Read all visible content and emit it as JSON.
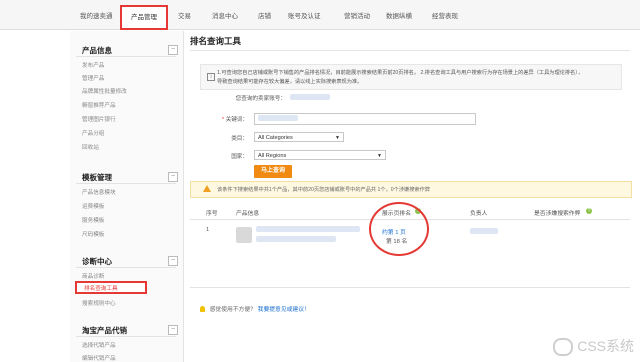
{
  "topnav": {
    "tabs": [
      {
        "label": "我的速卖通"
      },
      {
        "label": "产品管理"
      },
      {
        "label": "交易"
      },
      {
        "label": "消息中心"
      },
      {
        "label": "店铺"
      },
      {
        "label": "账号及认证"
      },
      {
        "label": "营销活动"
      },
      {
        "label": "数据纵横"
      },
      {
        "label": "经营表现"
      }
    ],
    "active_index": 1
  },
  "sidebar": {
    "sections": [
      {
        "title": "产品信息",
        "toggle": "−",
        "items": [
          "发布产品",
          "管理产品",
          "品牌属性批量修改",
          "橱窗推荐产品",
          "管理图片银行",
          "产品分组",
          "回收站"
        ]
      },
      {
        "title": "模板管理",
        "toggle": "−",
        "items": [
          "产品信息模块",
          "运费模板",
          "服务模板",
          "尺码模板"
        ]
      },
      {
        "title": "诊断中心",
        "toggle": "−",
        "items": [
          "商品诊断",
          "排名查询工具",
          "搜索规则中心"
        ]
      },
      {
        "title": "淘宝产品代销",
        "toggle": "−",
        "items": [
          "选择代销产品",
          "编辑代销产品"
        ]
      }
    ],
    "active_item": "排名查询工具"
  },
  "main": {
    "title": "排名查询工具",
    "notice_line1": "1.可查询您自己店铺或账号下销售的产品排名情况，目前能展示搜索结果页前20页排名。 2.排名查询工具与用户搜索行为存在场景上的差异（工具为理论排名），",
    "notice_line2": "导致查询结果可能存在较大偏差，请以线上实际搜索表现为准。",
    "form": {
      "account_label": "您查询的卖家账号：",
      "keyword_label": "关键词：",
      "category_label": "类目：",
      "category_value": "All Categories",
      "country_label": "国家：",
      "country_value": "All Regions",
      "submit_label": "马上查询"
    },
    "warning": "该条件下搜索结果中共1个产品，其中前20页您店铺或账号中的产品共 1个，0个涉嫌搜索作弊",
    "table": {
      "headers": [
        "序号",
        "产品信息",
        "展示页排名",
        "负责人",
        "是否涉嫌搜索作弊"
      ],
      "rows": [
        {
          "index": "1",
          "rank_page": "约第 1 页",
          "rank_pos": "第 18 名"
        }
      ]
    },
    "feedback_text": "感觉使用不方便？",
    "feedback_link": "我要提意见或建议！"
  },
  "watermark": "CSS系统",
  "colors": {
    "accent_red": "#e53935",
    "button_orange": "#f08a10",
    "link_blue": "#1a6fd1"
  }
}
